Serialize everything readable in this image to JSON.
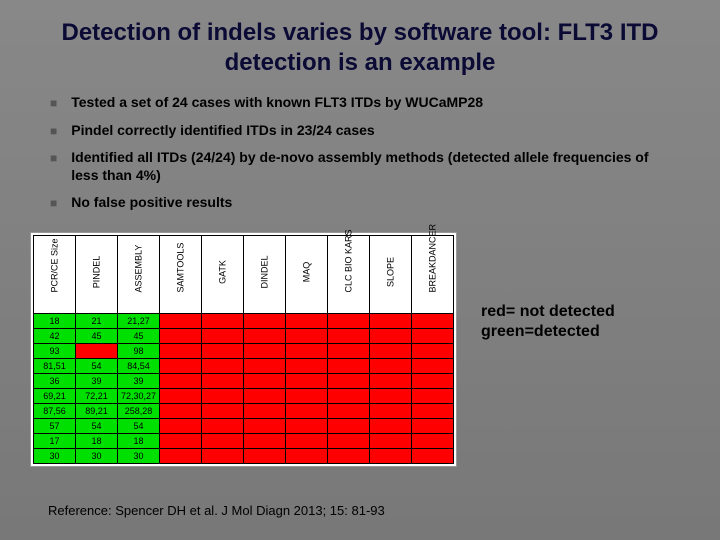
{
  "title": "Detection of indels varies by software tool: FLT3 ITD detection is an example",
  "bullets": [
    "Tested a set of 24 cases with known FLT3 ITDs by WUCaMP28",
    "Pindel correctly identified ITDs in 23/24 cases",
    "Identified all ITDs (24/24) by de-novo assembly methods (detected allele frequencies of less than 4%)",
    "No false positive results"
  ],
  "legend": {
    "line1": "red= not detected",
    "line2": "green=detected"
  },
  "reference": "Reference: Spencer DH et al.  J Mol Diagn 2013; 15: 81-93",
  "chart_data": {
    "type": "table",
    "columns": [
      "PCR/CE Size",
      "PINDEL",
      "ASSEMBLY",
      "SAMTOOLS",
      "GATK",
      "DINDEL",
      "MAQ",
      "CLC BIO KARS",
      "SLOPE",
      "BREAKDANCER"
    ],
    "rows": [
      {
        "cells": [
          "18",
          "21",
          "21,27",
          "",
          "",
          "",
          "",
          "",
          "",
          ""
        ],
        "status": [
          "g",
          "g",
          "g",
          "r",
          "r",
          "r",
          "r",
          "r",
          "r",
          "r"
        ]
      },
      {
        "cells": [
          "42",
          "45",
          "45",
          "",
          "",
          "",
          "",
          "",
          "",
          ""
        ],
        "status": [
          "g",
          "g",
          "g",
          "r",
          "r",
          "r",
          "r",
          "r",
          "r",
          "r"
        ]
      },
      {
        "cells": [
          "93",
          "",
          "98",
          "",
          "",
          "",
          "",
          "",
          "",
          ""
        ],
        "status": [
          "g",
          "r",
          "g",
          "r",
          "r",
          "r",
          "r",
          "r",
          "r",
          "r"
        ]
      },
      {
        "cells": [
          "81,51",
          "54",
          "84,54",
          "",
          "",
          "",
          "",
          "",
          "",
          ""
        ],
        "status": [
          "g",
          "g",
          "g",
          "r",
          "r",
          "r",
          "r",
          "r",
          "r",
          "r"
        ]
      },
      {
        "cells": [
          "36",
          "39",
          "39",
          "",
          "",
          "",
          "",
          "",
          "",
          ""
        ],
        "status": [
          "g",
          "g",
          "g",
          "r",
          "r",
          "r",
          "r",
          "r",
          "r",
          "r"
        ]
      },
      {
        "cells": [
          "69,21",
          "72,21",
          "72,30,27",
          "",
          "",
          "",
          "",
          "",
          "",
          ""
        ],
        "status": [
          "g",
          "g",
          "g",
          "r",
          "r",
          "r",
          "r",
          "r",
          "r",
          "r"
        ]
      },
      {
        "cells": [
          "87,56",
          "89,21",
          "258,28",
          "",
          "",
          "",
          "",
          "",
          "",
          ""
        ],
        "status": [
          "g",
          "g",
          "g",
          "r",
          "r",
          "r",
          "r",
          "r",
          "r",
          "r"
        ]
      },
      {
        "cells": [
          "57",
          "54",
          "54",
          "",
          "",
          "",
          "",
          "",
          "",
          ""
        ],
        "status": [
          "g",
          "g",
          "g",
          "r",
          "r",
          "r",
          "r",
          "r",
          "r",
          "r"
        ]
      },
      {
        "cells": [
          "17",
          "18",
          "18",
          "",
          "",
          "",
          "",
          "",
          "",
          ""
        ],
        "status": [
          "g",
          "g",
          "g",
          "r",
          "r",
          "r",
          "r",
          "r",
          "r",
          "r"
        ]
      },
      {
        "cells": [
          "30",
          "30",
          "30",
          "",
          "",
          "",
          "",
          "",
          "",
          ""
        ],
        "status": [
          "g",
          "g",
          "g",
          "r",
          "r",
          "r",
          "r",
          "r",
          "r",
          "r"
        ]
      }
    ]
  }
}
